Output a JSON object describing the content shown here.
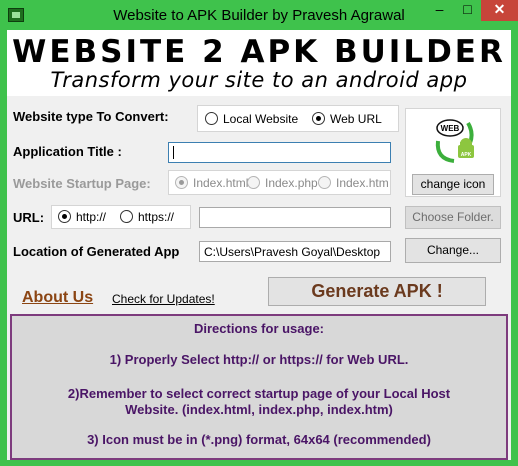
{
  "window": {
    "title": "Website to APK Builder by Pravesh Agrawal",
    "min_glyph": "–",
    "max_glyph": "□",
    "close_glyph": "✕"
  },
  "banner": {
    "title": "WEBSITE 2 APK BUILDER",
    "subtitle": "Transform your site to an android app"
  },
  "website_type": {
    "label": "Website type To Convert:",
    "options": [
      "Local Website",
      "Web URL"
    ],
    "selected": "Web URL"
  },
  "app_title": {
    "label": "Application Title :",
    "value": ""
  },
  "startup_page": {
    "label": "Website Startup Page:",
    "options": [
      "Index.html",
      "Index.php",
      "Index.htm"
    ],
    "selected": "Index.html",
    "enabled": false
  },
  "url": {
    "label": "URL:",
    "options": [
      "http://",
      "https://"
    ],
    "selected": "http://",
    "value": ""
  },
  "buttons": {
    "choose_folder": "Choose Folder.",
    "change_icon": "change icon",
    "change_location": "Change...",
    "generate": "Generate APK !"
  },
  "location": {
    "label": "Location of Generated App",
    "value": "C:\\Users\\Pravesh Goyal\\Desktop"
  },
  "icon_preview": {
    "badge_top": "WEB",
    "badge_bottom": "APK",
    "icon": "web-to-apk-android-icon"
  },
  "links": {
    "about": "About Us",
    "updates": "Check for Updates!"
  },
  "directions": {
    "heading": "Directions for usage:",
    "items": [
      "1) Properly Select http:// or https:// for Web URL.",
      "2)Remember to select correct startup page of your Local Host",
      "Website.  (index.html, index.php, index.htm)",
      "3) Icon must be in (*.png) format, 64x64 (recommended)"
    ]
  },
  "colors": {
    "titlebar": "#3fc24c",
    "close": "#c7453a",
    "about_link": "#8b4513",
    "directions_text": "#4a1566",
    "directions_border": "#7d3b7d",
    "generate_text": "#6b3a1e"
  }
}
